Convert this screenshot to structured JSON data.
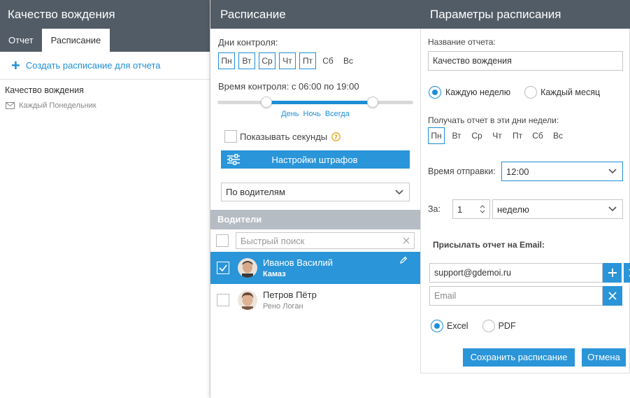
{
  "left": {
    "title": "Качество вождения",
    "tabs": [
      {
        "label": "Отчет"
      },
      {
        "label": "Расписание"
      }
    ],
    "create_link": "Создать расписание для отчета",
    "item": {
      "title": "Качество вождения",
      "schedule": "Каждый Понедельник"
    }
  },
  "middle": {
    "title": "Расписание",
    "days_label": "Дни контроля:",
    "days": [
      "Пн",
      "Вт",
      "Ср",
      "Чт",
      "Пт",
      "Сб",
      "Вс"
    ],
    "time_label": "Время контроля: с 06:00 по 19:00",
    "slider": {
      "from_hour": 6,
      "to_hour": 19,
      "max_hour": 24
    },
    "slider_links": [
      "День",
      "Ночь",
      "Всегда"
    ],
    "show_seconds": "Показывать секунды",
    "fines_button": "Настройки штрафов",
    "group_select": "По водителям",
    "drivers_header": "Водители",
    "search_placeholder": "Быстрый поиск",
    "drivers": [
      {
        "name": "Иванов Василий",
        "car": "Камаз"
      },
      {
        "name": "Петров Пётр",
        "car": "Рено Логан"
      }
    ]
  },
  "right": {
    "title": "Параметры расписания",
    "report_name_label": "Название отчета:",
    "report_name_value": "Качество вождения",
    "period_weekly": "Каждую неделю",
    "period_monthly": "Каждый месяц",
    "days_label": "Получать отчет в эти дни недели:",
    "days": [
      "Пн",
      "Вт",
      "Ср",
      "Чт",
      "Пт",
      "Сб",
      "Вс"
    ],
    "send_time_label": "Время отправки:",
    "send_time_value": "12:00",
    "every_label": "За:",
    "every_value": "1",
    "every_unit": "неделю",
    "email_label": "Присылать отчет на Email:",
    "email_value": "support@gdemoi.ru",
    "email_placeholder": "Email",
    "format_excel": "Excel",
    "format_pdf": "PDF",
    "save_button": "Сохранить расписание",
    "cancel_button": "Отмена"
  },
  "colors": {
    "accent": "#2a95d8",
    "header": "#525c66"
  }
}
